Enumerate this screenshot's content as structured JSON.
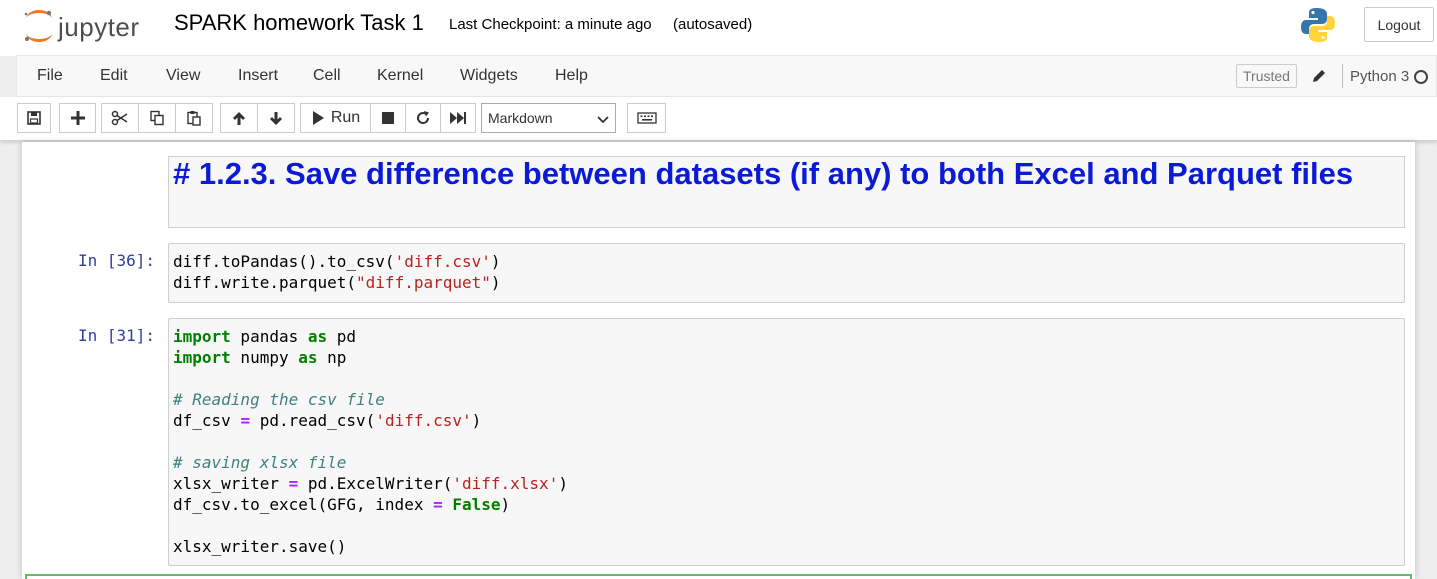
{
  "header": {
    "logo_text": "jupyter",
    "notebook_title": "SPARK homework Task 1",
    "checkpoint": "Last Checkpoint: a minute ago",
    "autosave_status": "(autosaved)",
    "logout_label": "Logout"
  },
  "menubar": {
    "items": [
      "File",
      "Edit",
      "View",
      "Insert",
      "Cell",
      "Kernel",
      "Widgets",
      "Help"
    ],
    "trusted_label": "Trusted",
    "kernel_name": "Python 3"
  },
  "toolbar": {
    "buttons": [
      "save-icon",
      "plus-icon",
      "scissors-icon",
      "copy-icon",
      "paste-icon",
      "arrow-up-icon",
      "arrow-down-icon",
      "run-icon",
      "stop-icon",
      "restart-icon",
      "fast-forward-icon",
      "keyboard-icon"
    ],
    "run_label": "Run",
    "cell_type_selected": "Markdown"
  },
  "cells": {
    "markdown": {
      "heading": "# 1.2.3. Save difference between datasets (if any) to both Excel and Parquet files"
    },
    "cell1": {
      "prompt": "In [36]:"
    },
    "cell2": {
      "prompt": "In [31]:"
    }
  },
  "colors": {
    "heading_blue": "#0a1ad6",
    "prompt_blue": "#303f9f",
    "keyword_green": "#008000",
    "string_red": "#ba2121",
    "comment_teal": "#408080",
    "operator_purple": "#aa22ff",
    "selected_cell_green": "#66bb6a"
  }
}
